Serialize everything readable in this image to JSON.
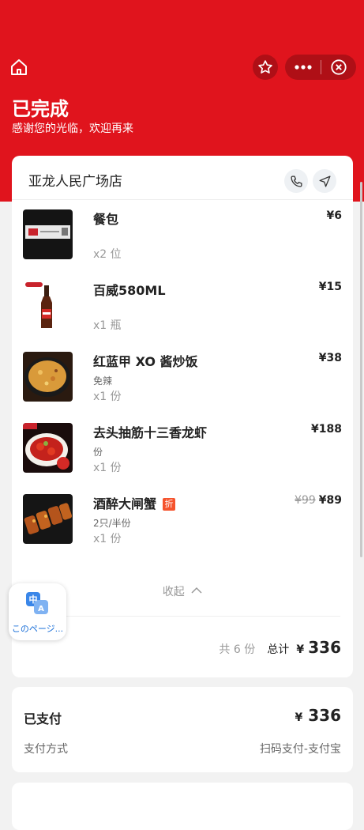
{
  "header": {
    "status_title": "已完成",
    "status_subtitle": "感谢您的光临，欢迎再来"
  },
  "icons": {
    "home": "home-icon",
    "favorite": "star-icon",
    "more": "more-dots-icon",
    "close": "close-circle-icon",
    "phone": "phone-icon",
    "navigate": "navigation-arrow-icon",
    "translate": "translate-icon"
  },
  "store": {
    "name": "亚龙人民广场店"
  },
  "items": [
    {
      "name": "餐包",
      "spec": "",
      "qty": "x2 位",
      "price": "¥6",
      "old_price": ""
    },
    {
      "name": "百威580ML",
      "spec": "",
      "qty": "x1 瓶",
      "price": "¥15",
      "old_price": ""
    },
    {
      "name": "红蓝甲 XO 酱炒饭",
      "spec": "免辣",
      "qty": "x1 份",
      "price": "¥38",
      "old_price": ""
    },
    {
      "name": "去头抽筋十三香龙虾",
      "spec": "份",
      "qty": "x1 份",
      "price": "¥188",
      "old_price": ""
    },
    {
      "name": "酒醉大闸蟹",
      "badge": "折",
      "spec": "2只/半份",
      "qty": "x1 份",
      "price": "¥89",
      "old_price": "¥99"
    }
  ],
  "collapse_label": "收起",
  "summary": {
    "count_text": "共 6 份",
    "total_label": "总计",
    "currency": "¥",
    "total_value": "336"
  },
  "payment": {
    "status_label": "已支付",
    "currency": "¥",
    "amount": "336",
    "method_label": "支付方式",
    "method_value": "扫码支付-支付宝"
  },
  "translate": {
    "label": "このページ..."
  },
  "colors": {
    "brand_red": "#e0141d",
    "badge_orange": "#f5532d",
    "translate_blue": "#1a6fd8"
  }
}
